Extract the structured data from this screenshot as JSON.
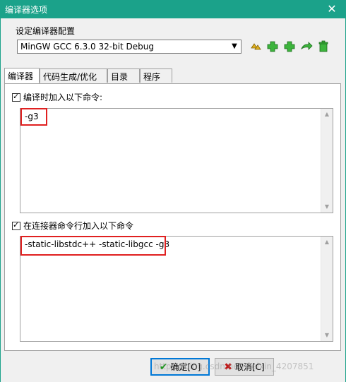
{
  "window": {
    "title": "编译器选项",
    "close_glyph": "✕"
  },
  "compiler_set": {
    "label": "设定编译器配置",
    "selected": "MinGW GCC 6.3.0 32-bit Debug"
  },
  "tabs": [
    {
      "label": "编译器"
    },
    {
      "label": "代码生成/优化"
    },
    {
      "label": "目录"
    },
    {
      "label": "程序"
    }
  ],
  "compile_cmd": {
    "checkbox_label": "编译时加入以下命令:",
    "checked": true,
    "text": "-g3"
  },
  "linker_cmd": {
    "checkbox_label": "在连接器命令行加入以下命令",
    "checked": true,
    "text": "-static-libstdc++ -static-libgcc -g3"
  },
  "buttons": {
    "ok_label": "确定[O]",
    "cancel_label": "取消[C]"
  },
  "watermark": "https://blog.csdn.net/weixin_4207851",
  "colors": {
    "titlebar": "#1ba28a",
    "highlight": "#e02020"
  }
}
